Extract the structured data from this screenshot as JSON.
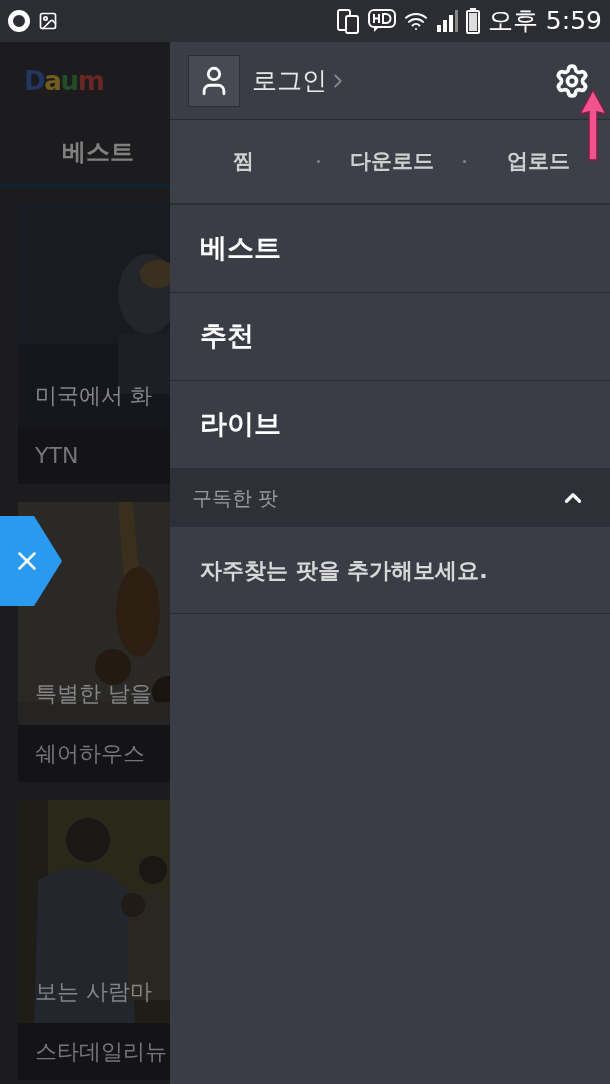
{
  "status_bar": {
    "time": "오후 5:59"
  },
  "background": {
    "logo": [
      "D",
      "a",
      "u",
      "m"
    ],
    "tab": "베스트",
    "cards": [
      {
        "title": "미국에서 화",
        "source": "YTN",
        "kind": "sport"
      },
      {
        "title": "특별한 날을",
        "source": "쉐어하우스",
        "kind": "food"
      },
      {
        "title": "보는 사람마",
        "source": "스타데일리뉴",
        "kind": "people"
      }
    ]
  },
  "drawer": {
    "login": "로그인",
    "quick_links": [
      "찜",
      "다운로드",
      "업로드"
    ],
    "menu": [
      "베스트",
      "추천",
      "라이브"
    ],
    "section": {
      "title": "구독한 팟",
      "expanded": true,
      "empty_message": "자주찾는 팟을 추가해보세요."
    }
  }
}
